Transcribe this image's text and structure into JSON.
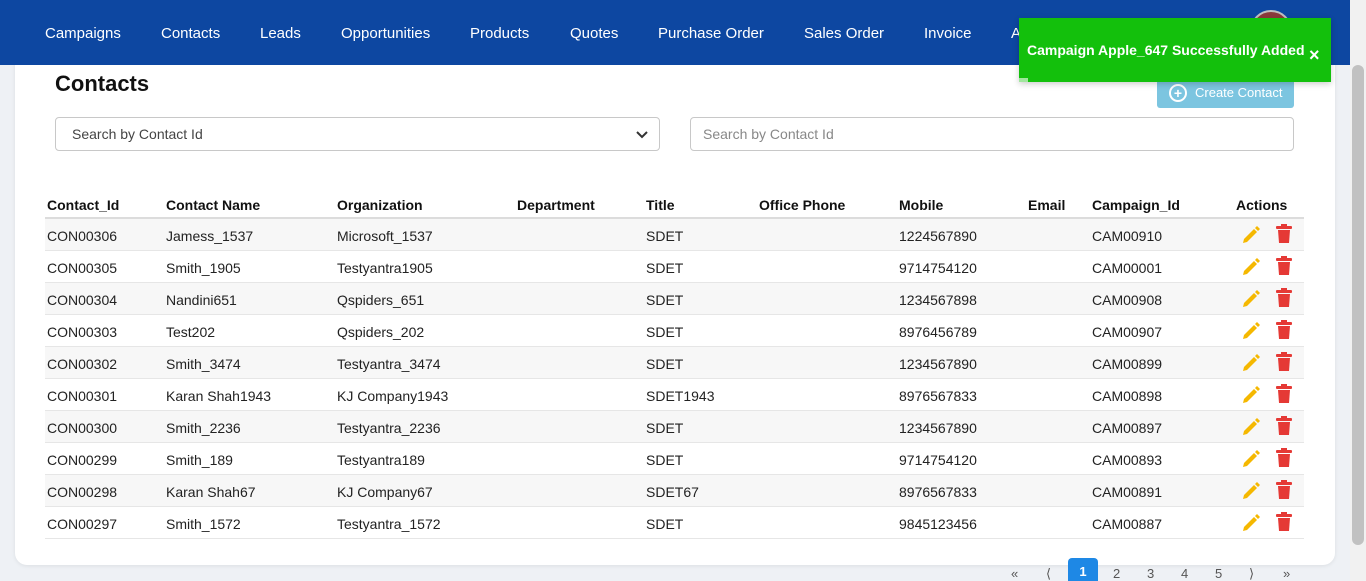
{
  "nav": {
    "items": [
      "Campaigns",
      "Contacts",
      "Leads",
      "Opportunities",
      "Products",
      "Quotes",
      "Purchase Order",
      "Sales Order",
      "Invoice",
      "A"
    ]
  },
  "page": {
    "title": "Contacts",
    "create_label": "Create Contact"
  },
  "filter": {
    "selected": "Search by Contact Id",
    "placeholder": "Search by Contact Id"
  },
  "table": {
    "headers": [
      "Contact_Id",
      "Contact Name",
      "Organization",
      "Department",
      "Title",
      "Office Phone",
      "Mobile",
      "Email",
      "Campaign_Id",
      "Actions"
    ],
    "rows": [
      [
        "CON00306",
        "Jamess_1537",
        "Microsoft_1537",
        "",
        "SDET",
        "",
        "1224567890",
        "",
        "CAM00910"
      ],
      [
        "CON00305",
        "Smith_1905",
        "Testyantra1905",
        "",
        "SDET",
        "",
        "9714754120",
        "",
        "CAM00001"
      ],
      [
        "CON00304",
        "Nandini651",
        "Qspiders_651",
        "",
        "SDET",
        "",
        "1234567898",
        "",
        "CAM00908"
      ],
      [
        "CON00303",
        "Test202",
        "Qspiders_202",
        "",
        "SDET",
        "",
        "8976456789",
        "",
        "CAM00907"
      ],
      [
        "CON00302",
        "Smith_3474",
        "Testyantra_3474",
        "",
        "SDET",
        "",
        "1234567890",
        "",
        "CAM00899"
      ],
      [
        "CON00301",
        "Karan Shah1943",
        "KJ Company1943",
        "",
        "SDET1943",
        "",
        "8976567833",
        "",
        "CAM00898"
      ],
      [
        "CON00300",
        "Smith_2236",
        "Testyantra_2236",
        "",
        "SDET",
        "",
        "1234567890",
        "",
        "CAM00897"
      ],
      [
        "CON00299",
        "Smith_189",
        "Testyantra189",
        "",
        "SDET",
        "",
        "9714754120",
        "",
        "CAM00893"
      ],
      [
        "CON00298",
        "Karan Shah67",
        "KJ Company67",
        "",
        "SDET67",
        "",
        "8976567833",
        "",
        "CAM00891"
      ],
      [
        "CON00297",
        "Smith_1572",
        "Testyantra_1572",
        "",
        "SDET",
        "",
        "9845123456",
        "",
        "CAM00887"
      ]
    ]
  },
  "pagination": {
    "first": "«",
    "prev": "⟨",
    "pages": [
      "1",
      "2",
      "3",
      "4",
      "5"
    ],
    "next": "⟩",
    "last": "»",
    "current": "1"
  },
  "toast": {
    "message": "Campaign Apple_647 Successfully Added",
    "close": "×"
  },
  "colors": {
    "nav_bg": "#0d47a1",
    "toast_bg": "#13c00c",
    "create_button": "#7cc5e0",
    "edit_icon": "#f5b800",
    "delete_icon": "#e53935",
    "active_page": "#1e88e5"
  },
  "icons": {
    "edit": "pencil-icon",
    "delete": "trash-icon",
    "create": "plus-circle-icon",
    "select": "chevron-down-icon"
  }
}
